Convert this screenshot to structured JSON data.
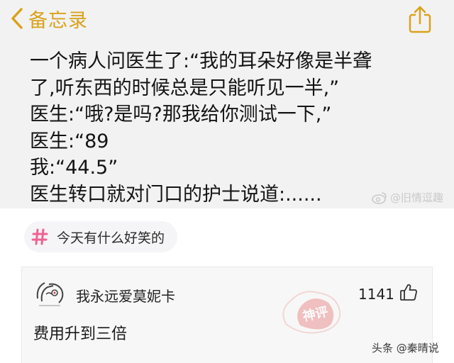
{
  "nav": {
    "back_label": "备忘录"
  },
  "note": {
    "lines": [
      "一个病人问医生了:“我的耳朵好像是半聋",
      "了,听东西的时候总是只能听见一半,”",
      "医生:“哦?是吗?那我给你测试一下,”",
      "医生:“89",
      "我:“44.5”",
      "医生转口就对门口的护士说道:......"
    ]
  },
  "weibo_watermark": "@旧情逗趣",
  "topic": {
    "label": "今天有什么好笑的"
  },
  "comment": {
    "username": "我永远爱莫妮卡",
    "likes": "1141",
    "text": "费用升到三倍",
    "stamp_text": "神评"
  },
  "source_watermark": "头条 @秦晴说",
  "colors": {
    "accent_gold": "#d9a21b",
    "topic_hash": "#f06292",
    "stamp_red": "#e57373"
  }
}
